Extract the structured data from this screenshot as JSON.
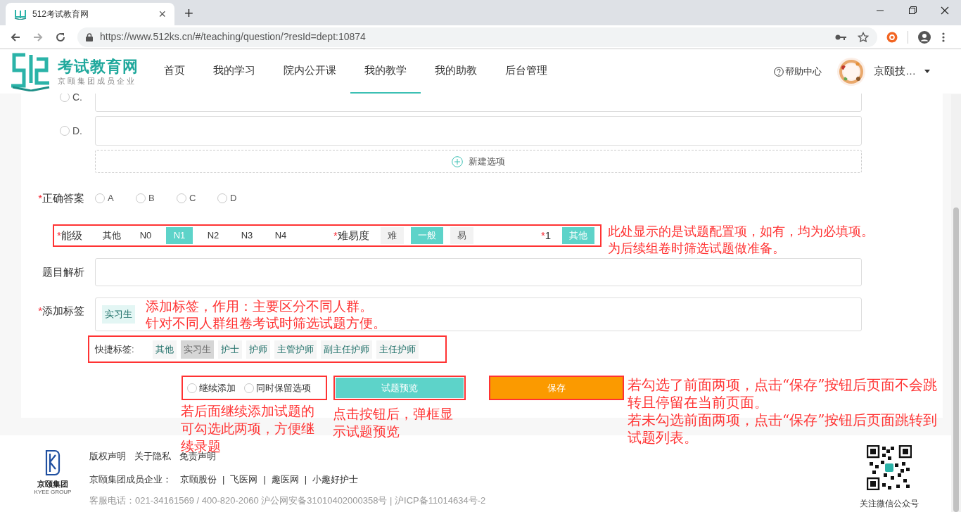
{
  "browser": {
    "tab_title": "512考试教育网",
    "tab_close": "×",
    "new_tab": "+",
    "url": "https://www.512ks.cn/#/teaching/question/?resId=dept:10874"
  },
  "nav": {
    "brand": "考试教育网",
    "brand_sub": "京颐集团成员企业",
    "items": [
      {
        "label": "首页",
        "selected": false
      },
      {
        "label": "我的学习",
        "selected": false
      },
      {
        "label": "院内公开课",
        "selected": false
      },
      {
        "label": "我的教学",
        "selected": true
      },
      {
        "label": "我的助教",
        "selected": false
      },
      {
        "label": "后台管理",
        "selected": false
      }
    ],
    "help": "帮助中心",
    "user": "京颐技…"
  },
  "form": {
    "options": [
      {
        "label": "C.",
        "selected": false
      },
      {
        "label": "D.",
        "selected": false
      }
    ],
    "add_option": "新建选项",
    "answer": {
      "asterisk": "*",
      "label": "正确答案",
      "choices": [
        {
          "label": "A",
          "selected": false
        },
        {
          "label": "B",
          "selected": false
        },
        {
          "label": "C",
          "selected": false
        },
        {
          "label": "D",
          "selected": false
        }
      ]
    },
    "config_groups": [
      {
        "asterisk": "*",
        "label": "能级",
        "kind": "plain",
        "options": [
          {
            "label": "其他",
            "selected": false
          },
          {
            "label": "N0",
            "selected": false
          },
          {
            "label": "N1",
            "selected": true
          },
          {
            "label": "N2",
            "selected": false
          },
          {
            "label": "N3",
            "selected": false
          },
          {
            "label": "N4",
            "selected": false
          }
        ]
      },
      {
        "asterisk": "*",
        "label": "难易度",
        "kind": "boxed",
        "options": [
          {
            "label": "难",
            "selected": false
          },
          {
            "label": "一般",
            "selected": true
          },
          {
            "label": "易",
            "selected": false
          }
        ]
      },
      {
        "asterisk": "*",
        "label": "1",
        "kind": "boxed",
        "options": [
          {
            "label": "其他",
            "selected": true
          }
        ]
      }
    ],
    "analysis": {
      "label": "题目解析"
    },
    "tags": {
      "asterisk": "*",
      "label": "添加标签",
      "items": [
        "实习生"
      ]
    },
    "quick_tags": {
      "label": "快捷标签:",
      "items": [
        {
          "label": "其他",
          "disabled": false
        },
        {
          "label": "实习生",
          "disabled": true
        },
        {
          "label": "护士",
          "disabled": false
        },
        {
          "label": "护师",
          "disabled": false
        },
        {
          "label": "主管护师",
          "disabled": false
        },
        {
          "label": "副主任护师",
          "disabled": false
        },
        {
          "label": "主任护师",
          "disabled": false
        }
      ]
    },
    "checks": [
      {
        "label": "继续添加",
        "checked": false
      },
      {
        "label": "同时保留选项",
        "checked": false
      }
    ],
    "preview_button": "试题预览",
    "save_button": "保存"
  },
  "annotations": [
    {
      "lines": [
        "此处显示的是试题配置项，如有，均为必填项。",
        "为后续组卷时筛选试题做准备。"
      ]
    },
    {
      "lines": [
        "添加标签，作用：主要区分不同人群。",
        "针对不同人群组卷考试时筛选试题方便。"
      ]
    },
    {
      "lines": [
        "若后面继续添加试题的可勾选此两项，方便继续录题"
      ]
    },
    {
      "lines": [
        "点击按钮后，弹框显示试题预览"
      ]
    },
    {
      "lines": [
        "若勾选了前面两项，点击“保存”按钮后页面不会跳转且停留在当前页面。",
        "若未勾选前面两项，点击“保存”按钮后页面跳转到试题列表。"
      ]
    }
  ],
  "footer": {
    "logo_name": "京颐集团",
    "logo_sub": "KYEE GROUP",
    "links": [
      "版权声明",
      "关于隐私",
      "免责声明"
    ],
    "members_label": "京颐集团成员企业：",
    "separator": "|",
    "members": [
      "京颐股份",
      "飞医网",
      "趣医网",
      "小趣好护士"
    ],
    "contact": "客服电话：021-34161569 / 400-820-2060 沪公网安备31010402000358号 | 沪ICP备11014634号-2",
    "qr_caption": "关注微信公众号"
  }
}
